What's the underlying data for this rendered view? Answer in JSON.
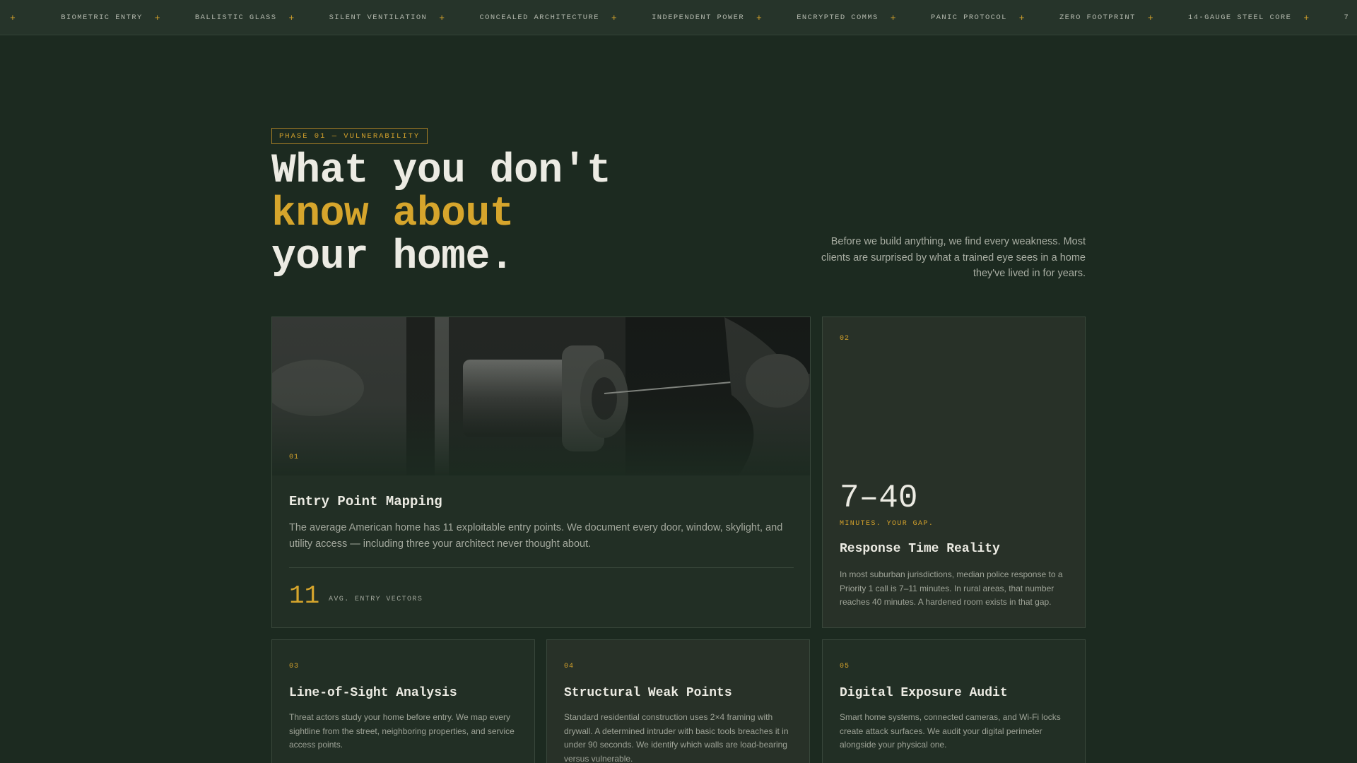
{
  "ticker": {
    "lead_glyph": "+",
    "items": [
      {
        "label": "BIOMETRIC ENTRY"
      },
      {
        "label": "BALLISTIC GLASS"
      },
      {
        "label": "SILENT VENTILATION"
      },
      {
        "label": "CONCEALED ARCHITECTURE"
      },
      {
        "label": "INDEPENDENT POWER"
      },
      {
        "label": "ENCRYPTED COMMS"
      },
      {
        "label": "PANIC PROTOCOL"
      },
      {
        "label": "ZERO FOOTPRINT"
      },
      {
        "label": "14-GAUGE STEEL CORE"
      }
    ],
    "separator": "+",
    "trailing": "7"
  },
  "hero": {
    "phase_tag": "PHASE 01 — VULNERABILITY",
    "headline_line1": "What you don't",
    "headline_line2": "know about",
    "headline_line3": "your home.",
    "intro": "Before we build anything, we find every weakness. Most clients are surprised by what a trained eye sees in a home they've lived in for years."
  },
  "cards": {
    "entry": {
      "num": "01",
      "title": "Entry Point Mapping",
      "text": "The average American home has 11 exploitable entry points. We document every door, window, skylight, and utility access — including three your architect never thought about.",
      "stat_value": "11",
      "stat_label": "AVG. ENTRY VECTORS"
    },
    "response": {
      "num": "02",
      "range": "7–40",
      "range_label": "MINUTES. YOUR GAP.",
      "title": "Response Time Reality",
      "text": "In most suburban jurisdictions, median police response to a Priority 1 call is 7–11 minutes. In rural areas, that number reaches 40 minutes. A hardened room exists in that gap."
    },
    "sightline": {
      "num": "03",
      "title": "Line-of-Sight Analysis",
      "text": "Threat actors study your home before entry. We map every sightline from the street, neighboring properties, and service access points."
    },
    "structural": {
      "num": "04",
      "title": "Structural Weak Points",
      "text": "Standard residential construction uses 2×4 framing with drywall. A determined intruder with basic tools breaches it in under 90 seconds. We identify which walls are load-bearing versus vulnerable."
    },
    "digital": {
      "num": "05",
      "title": "Digital Exposure Audit",
      "text": "Smart home systems, connected cameras, and Wi-Fi locks create attack surfaces. We audit your digital perimeter alongside your physical one."
    }
  },
  "colors": {
    "background": "#1c2a20",
    "accent": "#d6a52c",
    "card": "#222f25",
    "card_alt": "#283128"
  }
}
